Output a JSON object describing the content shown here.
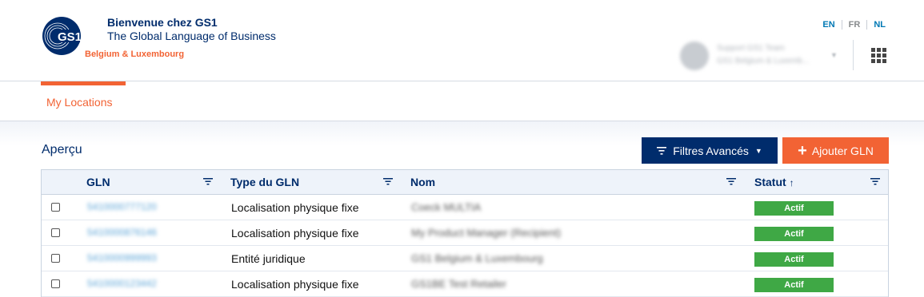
{
  "header": {
    "logo_text": "GS1",
    "brand_title": "Bienvenue chez GS1",
    "brand_subtitle": "The Global Language of Business",
    "brand_region": "Belgium & Luxembourg",
    "languages": [
      "EN",
      "FR",
      "NL"
    ],
    "active_language": "EN",
    "user_name": "Support GS1 Team",
    "user_org": "GS1 Belgium & Luxemb..."
  },
  "tabs": [
    {
      "label": "My Locations",
      "active": true
    }
  ],
  "main": {
    "section_title": "Aperçu",
    "filters_button": "Filtres Avancés",
    "add_button": "Ajouter GLN"
  },
  "table": {
    "columns": [
      "GLN",
      "Type du GLN",
      "Nom",
      "Statut"
    ],
    "sort_indicator": "↑",
    "rows": [
      {
        "gln": "5410000777120",
        "type": "Localisation physique fixe",
        "name": "Coeck MULTIA",
        "status": "Actif"
      },
      {
        "gln": "5410000876146",
        "type": "Localisation physique fixe",
        "name": "My Product Manager (Recipient)",
        "status": "Actif"
      },
      {
        "gln": "5410000999993",
        "type": "Entité juridique",
        "name": "GS1 Belgium & Luxembourg",
        "status": "Actif"
      },
      {
        "gln": "5410000123442",
        "type": "Localisation physique fixe",
        "name": "GS1BE Test Retailer",
        "status": "Actif"
      }
    ]
  },
  "colors": {
    "primary": "#002c6c",
    "accent": "#f26334",
    "link": "#0078b4",
    "status_active": "#3fa845"
  }
}
